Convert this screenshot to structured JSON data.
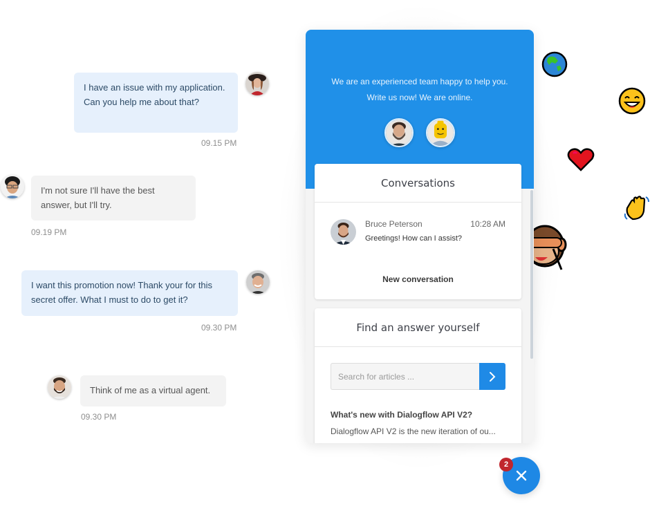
{
  "chat": {
    "messages": [
      {
        "sender": "user",
        "text": "I have an issue with my application. Can you help me about that?",
        "time": "09.15 PM",
        "avatar": "woman-avatar"
      },
      {
        "sender": "agent",
        "text": "I'm not sure I'll have the best answer, but I'll try.",
        "time": "09.19 PM",
        "avatar": "man-glasses-avatar"
      },
      {
        "sender": "user",
        "text": "I want this promotion now! Thank your for this secret offer. What I must to do to get it?",
        "time": "09.30 PM",
        "avatar": "man-smiling-avatar"
      },
      {
        "sender": "agent",
        "text": "Think of me as a virtual agent.",
        "time": "09.30 PM",
        "avatar": "man-beard-avatar"
      }
    ]
  },
  "panel": {
    "header": {
      "line1": "We are an experienced team happy to help you.",
      "line2": "Write us now! We are online.",
      "team_avatars": [
        "bearded-man-avatar",
        "lego-head-avatar"
      ]
    },
    "conversations": {
      "title": "Conversations",
      "items": [
        {
          "name": "Bruce Peterson",
          "time": "10:28 AM",
          "message": "Greetings! How can I assist?"
        }
      ],
      "new_conversation_label": "New conversation"
    },
    "find_answer": {
      "title": "Find an answer yourself",
      "search_placeholder": "Search for articles ...",
      "search_value": "",
      "articles": [
        {
          "title": "What's new with Dialogflow API V2?",
          "description": "Dialogflow API V2 is the new iteration of ou..."
        }
      ]
    }
  },
  "fab": {
    "badge_count": "2",
    "icon": "close-icon"
  },
  "decorations": {
    "emojis": [
      "globe-emoji",
      "grinning-face-emoji",
      "heart-emoji",
      "waving-hand-emoji",
      "see-no-evil-monkey-emoji"
    ]
  },
  "colors": {
    "brand_blue": "#2090e8",
    "user_bubble": "#e6f0fc",
    "agent_bubble": "#f3f3f3",
    "badge_red": "#c0262d"
  }
}
